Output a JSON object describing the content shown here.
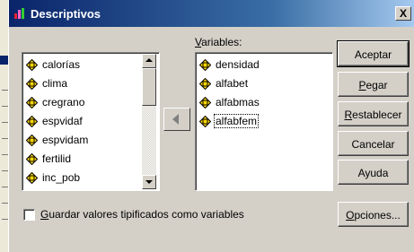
{
  "window": {
    "title": "Descriptivos",
    "close_glyph": "X"
  },
  "variables_label": {
    "mnemonic": "V",
    "rest": "ariables:"
  },
  "source_variables": [
    {
      "name": "calorías"
    },
    {
      "name": "clima"
    },
    {
      "name": "cregrano"
    },
    {
      "name": "espvidaf"
    },
    {
      "name": "espvidam"
    },
    {
      "name": "fertilid"
    },
    {
      "name": "inc_pob"
    }
  ],
  "target_variables": [
    {
      "name": "densidad"
    },
    {
      "name": "alfabet"
    },
    {
      "name": "alfabmas"
    },
    {
      "name": "alfabfem",
      "focused": true
    }
  ],
  "buttons": {
    "aceptar": "Aceptar",
    "pegar_mnemonic": "P",
    "pegar_rest": "egar",
    "restablecer_mnemonic": "R",
    "restablecer_rest": "establecer",
    "cancelar": "Cancelar",
    "ayuda": "Ayuda",
    "opciones_mnemonic": "O",
    "opciones_rest": "pciones..."
  },
  "checkbox": {
    "mnemonic": "G",
    "rest": "uardar valores tipificados como variables",
    "checked": false
  },
  "icons": {
    "variable_icon": "yellow-diamond-icon",
    "move_button": "left-arrow-icon",
    "scroll_up": "up-arrow-icon",
    "scroll_down": "down-arrow-icon"
  },
  "colors": {
    "title_start": "#0a246a",
    "title_end": "#a6caf0",
    "face": "#d4d0c8"
  }
}
